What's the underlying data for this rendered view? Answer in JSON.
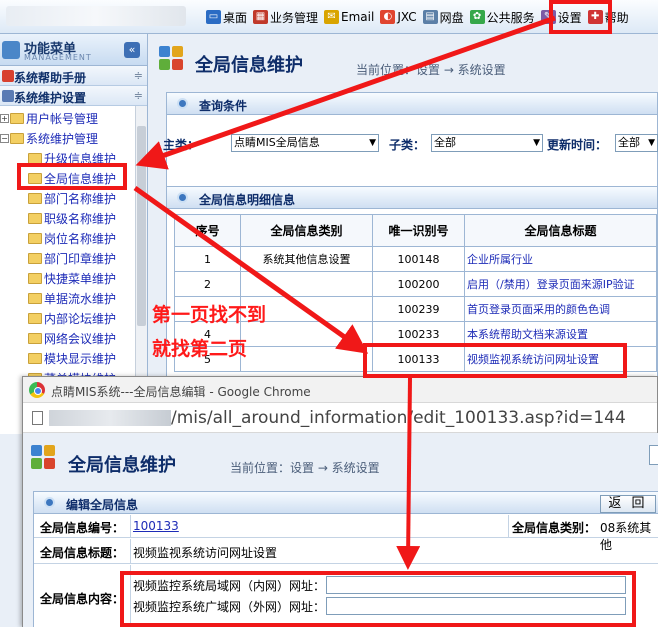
{
  "topnav": [
    {
      "label": "桌面",
      "icon": "desktop-icon",
      "color": "#2b6cc4"
    },
    {
      "label": "业务管理",
      "icon": "grid-icon",
      "color": "#c0392b"
    },
    {
      "label": "Email",
      "icon": "email-icon",
      "color": "#d9a400"
    },
    {
      "label": "JXC",
      "icon": "chart-icon",
      "color": "#e0452f"
    },
    {
      "label": "网盘",
      "icon": "disk-icon",
      "color": "#5b7fa7"
    },
    {
      "label": "公共服务",
      "icon": "pinwheel-icon",
      "color": "#36a84a"
    },
    {
      "label": "设置",
      "icon": "settings-wrench-icon",
      "color": "#7d5ba6"
    },
    {
      "label": "帮助",
      "icon": "help-icon",
      "color": "#d03434"
    }
  ],
  "sidebar": {
    "title": "功能菜单",
    "subtitle": "MANAGEMENT",
    "collapse_symbol": "«",
    "sections": [
      {
        "label": "系统帮助手册",
        "ctrl": "≑"
      },
      {
        "label": "系统维护设置",
        "ctrl": "≑"
      }
    ],
    "tree": [
      {
        "label": "用户帐号管理",
        "expander": "+"
      },
      {
        "label": "系统维护管理",
        "expander": "−"
      },
      {
        "label": "升级信息维护"
      },
      {
        "label": "全局信息维护"
      },
      {
        "label": "部门名称维护"
      },
      {
        "label": "职级名称维护"
      },
      {
        "label": "岗位名称维护"
      },
      {
        "label": "部门印章维护"
      },
      {
        "label": "快捷菜单维护"
      },
      {
        "label": "单据流水维护"
      },
      {
        "label": "内部论坛维护"
      },
      {
        "label": "网络会议维护"
      },
      {
        "label": "模块显示维护"
      },
      {
        "label": "菜单模块维护"
      }
    ]
  },
  "main": {
    "title": "全局信息维护",
    "location": "当前位置：设置  →  系统设置",
    "query_panel_title": "查询条件",
    "query": {
      "main_label": "主类：",
      "main_value": "点睛MIS全局信息",
      "sub_label": "子类：",
      "sub_value": "全部",
      "time_label": "更新时间：",
      "time_value": "全部"
    },
    "detail_panel_title": "全局信息明细信息",
    "columns": [
      "序号",
      "全局信息类别",
      "唯一识别号",
      "全局信息标题"
    ],
    "rows": [
      {
        "no": "1",
        "cat": "系统其他信息设置",
        "id": "100148",
        "title": "企业所属行业"
      },
      {
        "no": "2",
        "cat": "",
        "id": "100200",
        "title": "启用（/禁用）登录页面来源IP验证"
      },
      {
        "no": "",
        "cat": "",
        "id": "100239",
        "title": "首页登录页面采用的颜色色调"
      },
      {
        "no": "4",
        "cat": "",
        "id": "100233",
        "title": "本系统帮助文档来源设置"
      },
      {
        "no": "5",
        "cat": "",
        "id": "100133",
        "title": "视频监视系统访问网址设置"
      }
    ]
  },
  "annotation": {
    "line1": "第一页找不到",
    "line2": "就找第二页"
  },
  "chrome": {
    "window_title": "点睛MIS系统---全局信息编辑 - Google Chrome",
    "url_path": "/mis/all_around_information/edit_100133.asp?id=144",
    "page_title": "全局信息维护",
    "location": "当前位置：设置  →  系统设置",
    "edit_panel_title": "编辑全局信息",
    "back_label": "返 回",
    "fields": {
      "number_label": "全局信息编号：",
      "number_value": "100133",
      "category_label": "全局信息类别：",
      "category_value": "08系统其他",
      "title_label": "全局信息标题：",
      "title_value": "视频监视系统访问网址设置",
      "content_label": "全局信息内容：",
      "content_line1": "视频监控系统局域网（内网）网址：",
      "content_line2": "视频监控系统广域网（外网）网址："
    }
  }
}
